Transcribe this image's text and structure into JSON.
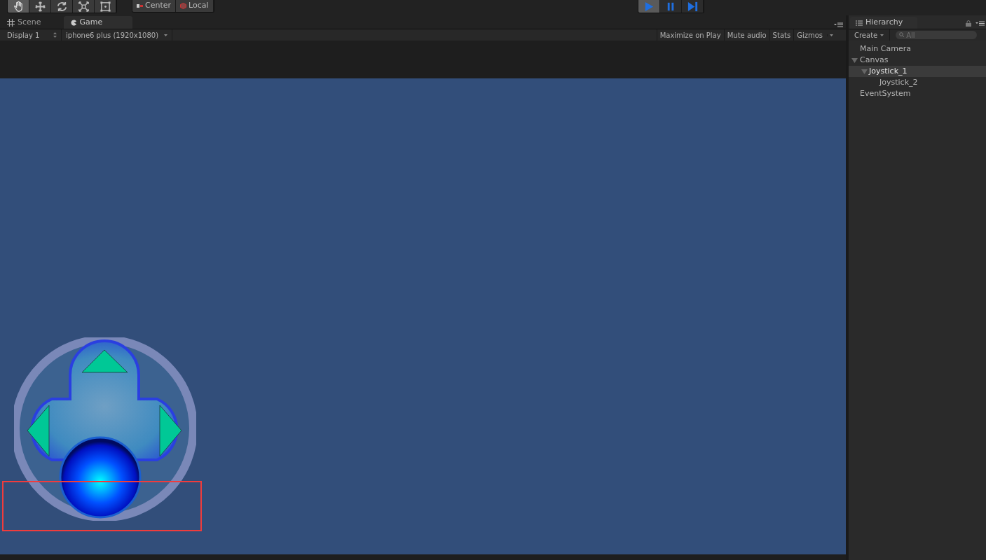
{
  "toolbar": {
    "tools": [
      {
        "kind": "hand",
        "selected": true
      },
      {
        "kind": "move",
        "selected": false
      },
      {
        "kind": "rotate",
        "selected": false
      },
      {
        "kind": "scale",
        "selected": false
      },
      {
        "kind": "rect",
        "selected": false
      }
    ],
    "pivot_buttons": [
      {
        "kind": "center",
        "label": "Center"
      },
      {
        "kind": "local",
        "label": "Local"
      }
    ],
    "play_controls": [
      {
        "kind": "play",
        "selected": true
      },
      {
        "kind": "pause",
        "selected": false
      },
      {
        "kind": "step",
        "selected": false
      }
    ]
  },
  "tabs": [
    {
      "kind": "scene",
      "label": "Scene",
      "selected": false
    },
    {
      "kind": "game",
      "label": "Game",
      "selected": true
    }
  ],
  "game_toolbar": {
    "display": "Display 1",
    "resolution": "iphone6 plus (1920x1080)",
    "toggles": [
      "Maximize on Play",
      "Mute audio",
      "Stats",
      "Gizmos"
    ]
  },
  "hierarchy": {
    "title": "Hierarchy",
    "create": "Create",
    "search": {
      "placeholder": "All"
    },
    "items": [
      {
        "label": "Main Camera",
        "selected": false
      },
      {
        "label": "Canvas",
        "expanded": true,
        "selected": false,
        "children": [
          {
            "label": "Joystick_1",
            "expanded": true,
            "selected": true,
            "children": [
              {
                "label": "Joystick_2",
                "selected": false
              }
            ]
          }
        ]
      },
      {
        "label": "EventSystem",
        "selected": false
      }
    ]
  }
}
